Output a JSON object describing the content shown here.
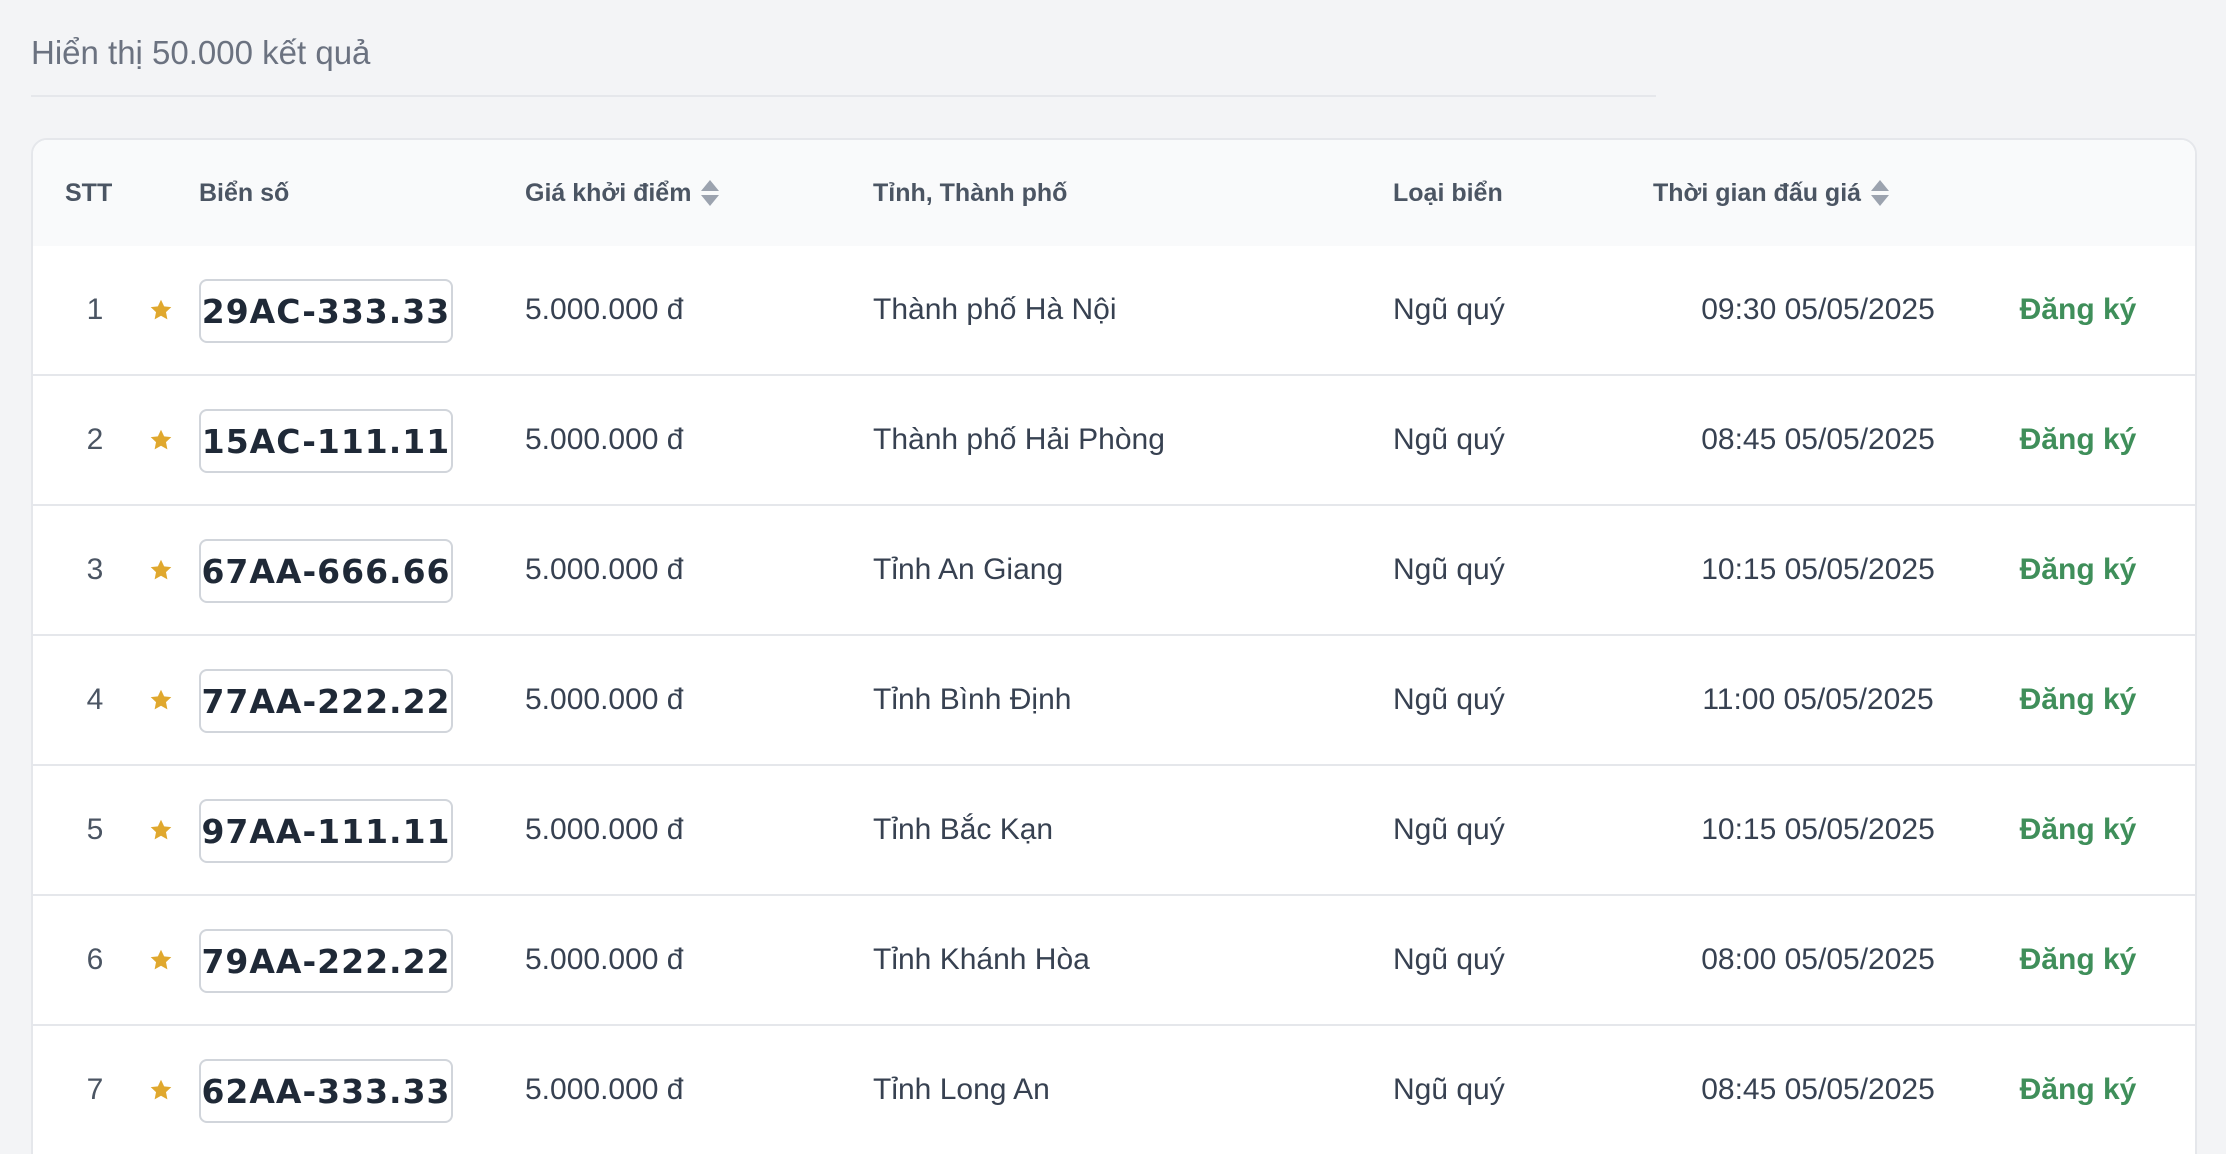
{
  "summary": {
    "text": "Hiển thị 50.000 kết quả"
  },
  "table": {
    "headers": {
      "stt": "STT",
      "plate": "Biển số",
      "price": "Giá khởi điểm",
      "province": "Tỉnh, Thành phố",
      "type": "Loại biển",
      "time": "Thời gian đấu giá"
    },
    "rows": [
      {
        "stt": "1",
        "plate": "29AC-333.33",
        "price": "5.000.000 đ",
        "province": "Thành phố Hà Nội",
        "type": "Ngũ quý",
        "time": "09:30 05/05/2025",
        "action": "Đăng ký"
      },
      {
        "stt": "2",
        "plate": "15AC-111.11",
        "price": "5.000.000 đ",
        "province": "Thành phố Hải Phòng",
        "type": "Ngũ quý",
        "time": "08:45 05/05/2025",
        "action": "Đăng ký"
      },
      {
        "stt": "3",
        "plate": "67AA-666.66",
        "price": "5.000.000 đ",
        "province": "Tỉnh An Giang",
        "type": "Ngũ quý",
        "time": "10:15 05/05/2025",
        "action": "Đăng ký"
      },
      {
        "stt": "4",
        "plate": "77AA-222.22",
        "price": "5.000.000 đ",
        "province": "Tỉnh Bình Định",
        "type": "Ngũ quý",
        "time": "11:00 05/05/2025",
        "action": "Đăng ký"
      },
      {
        "stt": "5",
        "plate": "97AA-111.11",
        "price": "5.000.000 đ",
        "province": "Tỉnh Bắc Kạn",
        "type": "Ngũ quý",
        "time": "10:15 05/05/2025",
        "action": "Đăng ký"
      },
      {
        "stt": "6",
        "plate": "79AA-222.22",
        "price": "5.000.000 đ",
        "province": "Tỉnh Khánh Hòa",
        "type": "Ngũ quý",
        "time": "08:00 05/05/2025",
        "action": "Đăng ký"
      },
      {
        "stt": "7",
        "plate": "62AA-333.33",
        "price": "5.000.000 đ",
        "province": "Tỉnh Long An",
        "type": "Ngũ quý",
        "time": "08:45 05/05/2025",
        "action": "Đăng ký"
      }
    ]
  },
  "icons": {
    "favorite": "star-icon",
    "sort": "sort-icon"
  },
  "colors": {
    "accent_green": "#3f8f5a",
    "star_gold": "#e0a82e",
    "header_bg": "#f9fafb",
    "border": "#e5e7eb"
  }
}
